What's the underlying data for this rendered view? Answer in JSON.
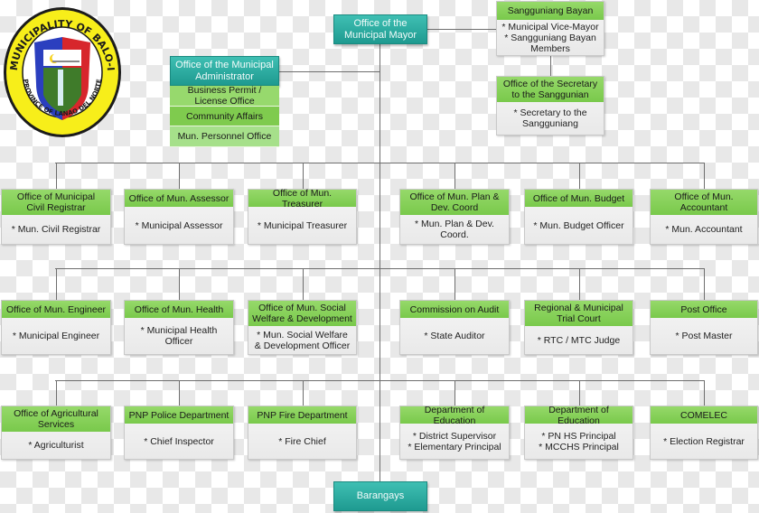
{
  "logo": {
    "name": "municipality-seal",
    "ring_top_text": "MUNICIPALITY OF BALO-I",
    "ring_bottom_text": "PROVINCE OF LANAO DEL NORTE",
    "colors": {
      "ring": "#f7ee1a",
      "outline": "#1b1b1b",
      "blue": "#2b3fbf",
      "red": "#d7262c"
    }
  },
  "colors": {
    "teal": "#2aa89d",
    "header_green": "#86d05b",
    "body_gray": "#efefef",
    "connector": "#6e6e6e"
  },
  "mayor": {
    "label": "Office of the\nMunicipal Mayor"
  },
  "administrator": {
    "label": "Office of the Municipal\nAdministrator",
    "units": [
      {
        "label": "Business Permit /\nLicense Office"
      },
      {
        "label": "Community Affairs"
      },
      {
        "label": "Mun. Personnel Office"
      }
    ]
  },
  "sangguniang": {
    "title": "Sangguniang Bayan",
    "members": "* Municipal Vice-Mayor\n* Sangguniang Bayan\nMembers"
  },
  "secretary": {
    "title": "Office of the Secretary\nto the Sanggunian",
    "members": "* Secretary to the\nSangguniang"
  },
  "rows": [
    [
      {
        "title": "Office of Municipal\nCivil Registrar",
        "body": "* Mun. Civil Registrar"
      },
      {
        "title": "Office of Mun. Assessor",
        "body": "* Municipal Assessor"
      },
      {
        "title": "Office of Mun. Treasurer",
        "body": "* Municipal Treasurer"
      },
      {
        "title": "Office of Mun. Plan &\nDev. Coord",
        "body": "* Mun. Plan & Dev.\nCoord."
      },
      {
        "title": "Office of Mun. Budget",
        "body": "* Mun. Budget Officer"
      },
      {
        "title": "Office of Mun.\nAccountant",
        "body": "* Mun. Accountant"
      }
    ],
    [
      {
        "title": "Office of Mun. Engineer",
        "body": "* Municipal Engineer"
      },
      {
        "title": "Office of Mun. Health",
        "body": "* Municipal Health\nOfficer"
      },
      {
        "title": "Office of Mun. Social\nWelfare & Development",
        "body": "* Mun. Social Welfare\n& Development Officer"
      },
      {
        "title": "Commission on Audit",
        "body": "* State Auditor"
      },
      {
        "title": "Regional & Municipal\nTrial Court",
        "body": "* RTC / MTC Judge"
      },
      {
        "title": "Post Office",
        "body": "* Post Master"
      }
    ],
    [
      {
        "title": "Office of Agricultural\nServices",
        "body": "* Agriculturist"
      },
      {
        "title": "PNP Police Department",
        "body": "* Chief Inspector"
      },
      {
        "title": "PNP Fire Department",
        "body": "* Fire Chief"
      },
      {
        "title": "Department of Education",
        "body": "* District Supervisor\n* Elementary Principal"
      },
      {
        "title": "Department of Education",
        "body": "* PN HS Principal\n* MCCHS Principal"
      },
      {
        "title": "COMELEC",
        "body": "* Election Registrar"
      }
    ]
  ],
  "barangays": {
    "label": "Barangays"
  }
}
